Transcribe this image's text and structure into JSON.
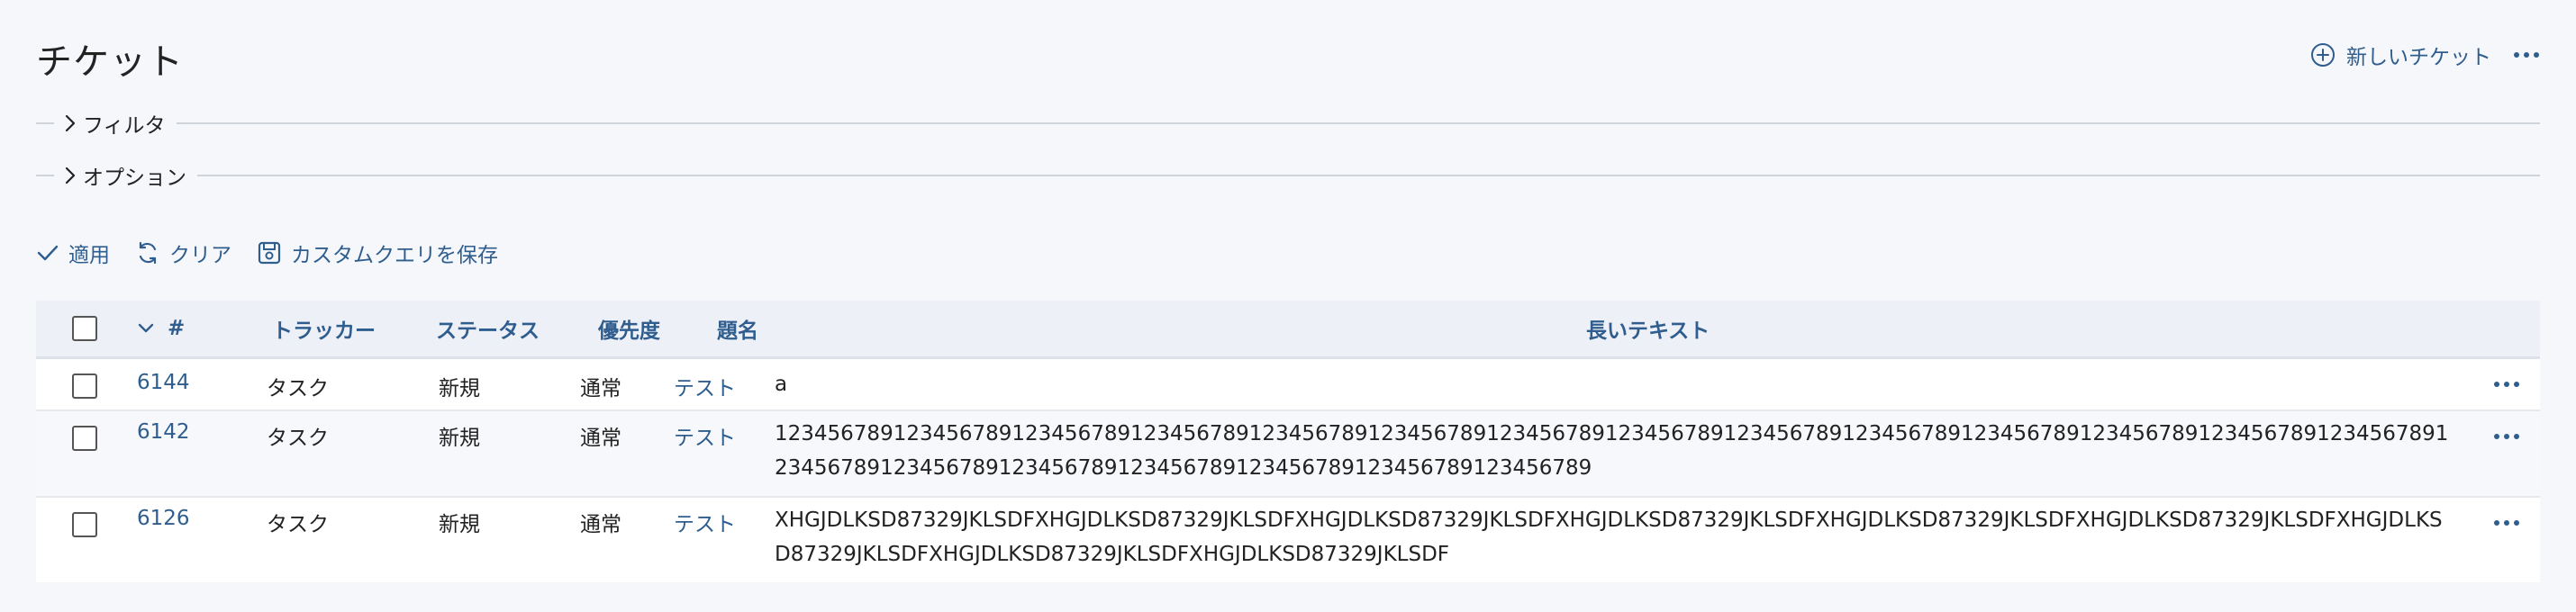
{
  "page": {
    "title": "チケット"
  },
  "header": {
    "new_ticket_label": "新しいチケット"
  },
  "filters": {
    "filter_label": "フィルタ",
    "options_label": "オプション"
  },
  "query_actions": {
    "apply": "適用",
    "clear": "クリア",
    "save_custom_query": "カスタムクエリを保存"
  },
  "table": {
    "columns": {
      "id": "#",
      "tracker": "トラッカー",
      "status": "ステータス",
      "priority": "優先度",
      "subject": "題名",
      "long_text": "長いテキスト"
    },
    "sort": {
      "column": "#",
      "direction": "descending"
    },
    "rows": [
      {
        "id": "6144",
        "tracker": "タスク",
        "status": "新規",
        "priority": "通常",
        "subject": "テスト",
        "long_text": "a"
      },
      {
        "id": "6142",
        "tracker": "タスク",
        "status": "新規",
        "priority": "通常",
        "subject": "テスト",
        "long_text": "123456789123456789123456789123456789123456789123456789123456789123456789123456789123456789123456789123456789123456789123456789123456789123456789123456789123456789123456789123456789123456789"
      },
      {
        "id": "6126",
        "tracker": "タスク",
        "status": "新規",
        "priority": "通常",
        "subject": "テスト",
        "long_text": "XHGJDLKSD87329JKLSDFXHGJDLKSD87329JKLSDFXHGJDLKSD87329JKLSDFXHGJDLKSD87329JKLSDFXHGJDLKSD87329JKLSDFXHGJDLKSD87329JKLSDFXHGJDLKSD87329JKLSDFXHGJDLKSD87329JKLSDFXHGJDLKSD87329JKLSDF"
      }
    ]
  },
  "colors": {
    "accent": "#2f5e8e",
    "header_bg": "#eef0f8",
    "page_bg": "#f6f7fb"
  },
  "icons": [
    "plus-circle-icon",
    "more-horizontal-icon",
    "chevron-right-icon",
    "check-icon",
    "refresh-icon",
    "save-icon",
    "chevron-down-icon"
  ]
}
